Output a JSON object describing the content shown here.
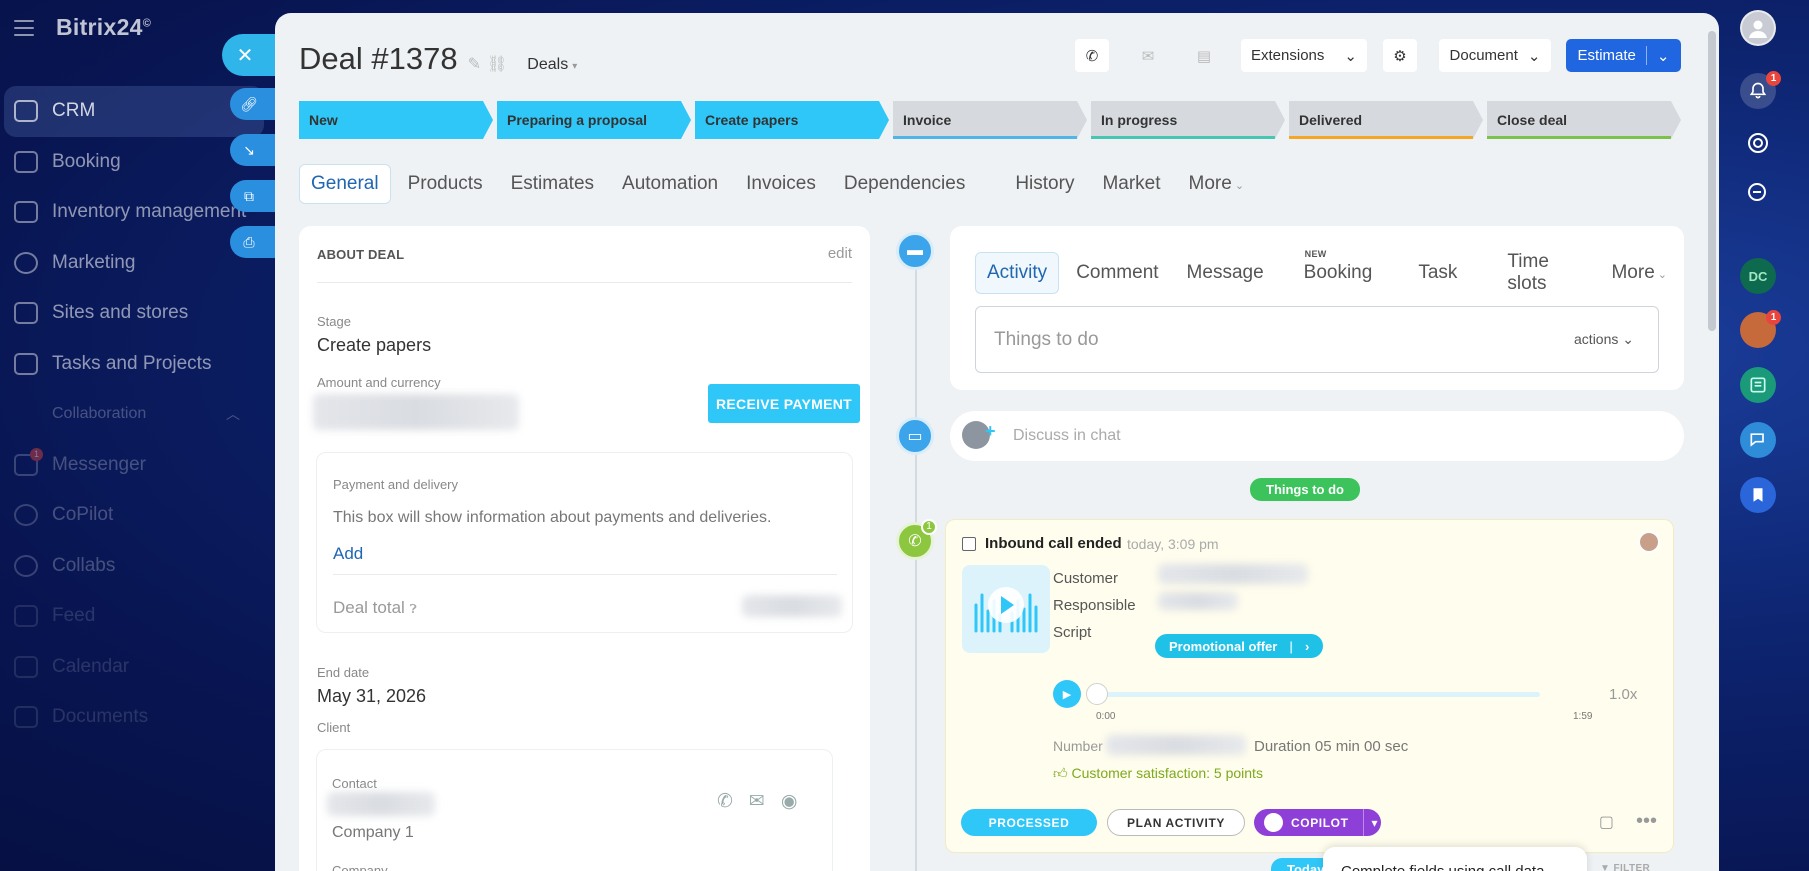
{
  "sidebar": {
    "logo": "Bitrix24",
    "logo_mark": "©",
    "items": [
      {
        "label": "CRM",
        "icon": "funnel-icon",
        "badge": ""
      },
      {
        "label": "Booking",
        "icon": "calendar-grid-icon",
        "badge": ""
      },
      {
        "label": "Inventory management",
        "icon": "inventory-icon",
        "badge": ""
      },
      {
        "label": "Marketing",
        "icon": "target-icon",
        "badge": ""
      },
      {
        "label": "Sites and stores",
        "icon": "cart-icon",
        "badge": ""
      },
      {
        "label": "Tasks and Projects",
        "icon": "checkbox-icon",
        "badge": ""
      },
      {
        "label": "Collaboration",
        "icon": "",
        "badge": ""
      },
      {
        "label": "Messenger",
        "icon": "chat-icon",
        "badge": "1"
      },
      {
        "label": "CoPilot",
        "icon": "copilot-icon",
        "badge": ""
      },
      {
        "label": "Collabs",
        "icon": "collabs-icon",
        "badge": ""
      },
      {
        "label": "Feed",
        "icon": "feed-icon",
        "badge": ""
      },
      {
        "label": "Calendar",
        "icon": "calendar-icon",
        "badge": ""
      },
      {
        "label": "Documents",
        "icon": "documents-icon",
        "badge": ""
      }
    ]
  },
  "right_rail": {
    "notifications_badge": "1",
    "contact_initials": "DC",
    "avatar_badge": "1"
  },
  "header": {
    "title": "Deal #1378",
    "entity_selector": "Deals",
    "extensions_label": "Extensions",
    "document_label": "Document",
    "estimate_label": "Estimate"
  },
  "stages": [
    {
      "label": "New",
      "state": "done",
      "color": "#2fc7f7"
    },
    {
      "label": "Preparing a proposal",
      "state": "done",
      "color": "#2fc7f7"
    },
    {
      "label": "Create papers",
      "state": "done",
      "color": "#2fc7f7"
    },
    {
      "label": "Invoice",
      "state": "todo",
      "color": "#4fb4e6"
    },
    {
      "label": "In progress",
      "state": "todo",
      "color": "#49c6b2"
    },
    {
      "label": "Delivered",
      "state": "todo",
      "color": "#f5a623"
    },
    {
      "label": "Close deal",
      "state": "todo",
      "color": "#7cc24a"
    }
  ],
  "tabs": {
    "items": [
      "General",
      "Products",
      "Estimates",
      "Automation",
      "Invoices",
      "Dependencies",
      "History",
      "Market"
    ],
    "more": "More"
  },
  "about": {
    "header": "ABOUT DEAL",
    "edit": "edit",
    "stage_label": "Stage",
    "stage_value": "Create papers",
    "amount_label": "Amount and currency",
    "receive_payment": "RECEIVE PAYMENT",
    "payment_title": "Payment and delivery",
    "payment_info": "This box will show information about payments and deliveries.",
    "payment_add": "Add",
    "deal_total_label": "Deal total",
    "end_date_label": "End date",
    "end_date_value": "May 31, 2026",
    "client_label": "Client",
    "contact_label": "Contact",
    "company_value": "Company 1",
    "company_label": "Company"
  },
  "activity": {
    "tabs": [
      "Activity",
      "Comment",
      "Message",
      "Booking",
      "Task",
      "Time slots"
    ],
    "new_badge": "NEW",
    "more": "More",
    "todo_placeholder": "Things to do",
    "actions_label": "actions"
  },
  "chat": {
    "placeholder": "Discuss in chat"
  },
  "timeline": {
    "things_to_do_pill": "Things to do",
    "call_badge": "1",
    "today_pill": "Today",
    "filter_label": "FILTER"
  },
  "call": {
    "title": "Inbound call ended",
    "time": "today, 3:09 pm",
    "customer_label": "Customer",
    "responsible_label": "Responsible",
    "script_label": "Script",
    "script_value": "Promotional offer",
    "time_start": "0:00",
    "time_end": "1:59",
    "playback_position": 0,
    "speed": "1.0x",
    "number_label": "Number",
    "duration": "Duration 05 min 00 sec",
    "satisfaction": "Customer satisfaction: 5 points",
    "processed_btn": "PROCESSED",
    "plan_btn": "PLAN ACTIVITY",
    "copilot_btn": "COPILOT"
  },
  "tooltip": {
    "text": "Complete fields using call data"
  }
}
